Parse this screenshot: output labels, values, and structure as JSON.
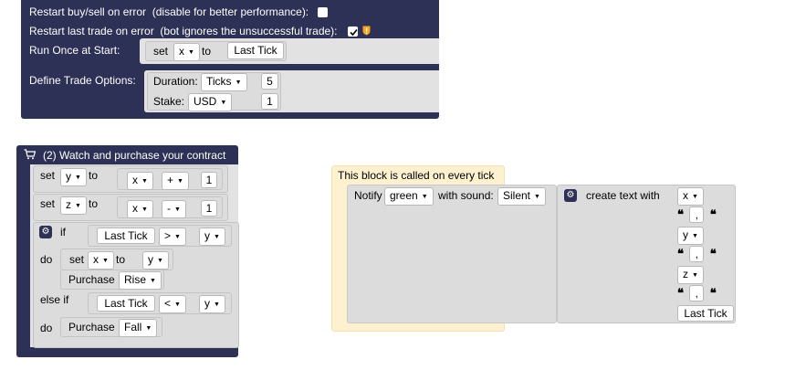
{
  "options_block": {
    "restart_buysell_label": "Restart buy/sell on error",
    "restart_buysell_hint": "(disable for better performance):",
    "restart_last_label": "Restart last trade on error",
    "restart_last_hint": "(bot ignores the unsuccessful trade):",
    "run_once_label": "Run Once at Start:",
    "set_label": "set",
    "set_var": "x",
    "to_label": "to",
    "last_tick": "Last Tick",
    "define_trade_label": "Define Trade Options:",
    "duration_label": "Duration:",
    "duration_unit": "Ticks",
    "duration_value": "5",
    "stake_label": "Stake:",
    "stake_currency": "USD",
    "stake_value": "1"
  },
  "watch_block": {
    "title": "(2) Watch and purchase your contract",
    "set_label": "set",
    "to_label": "to",
    "row1": {
      "var": "y",
      "lhs": "x",
      "op": "+",
      "rhs": "1"
    },
    "row2": {
      "var": "z",
      "lhs": "x",
      "op": "-",
      "rhs": "1"
    },
    "if_label": "if",
    "if_lhs": "Last Tick",
    "if_op": ">",
    "if_rhs": "y",
    "do_label": "do",
    "do_set_var": "x",
    "do_set_value": "y",
    "purchase_label": "Purchase",
    "purchase_rise": "Rise",
    "elseif_label": "else if",
    "elseif_lhs": "Last Tick",
    "elseif_op": "<",
    "elseif_rhs": "y",
    "do2_label": "do",
    "purchase_fall": "Fall"
  },
  "tick_block": {
    "comment": "This block is called on every tick",
    "notify_label": "Notify",
    "notify_color": "green",
    "with_sound_label": "with sound:",
    "sound": "Silent",
    "create_text_label": "create text with",
    "items": [
      "x",
      "\",\"",
      "y",
      "\",\"",
      "z",
      "\",\"",
      "Last Tick"
    ],
    "comma": ","
  },
  "colors": {
    "block_navy": "#2c3155",
    "block_grey": "#dcdcdc",
    "comment_yellow": "#fdf1cf",
    "warning_orange": "#f5a623"
  }
}
